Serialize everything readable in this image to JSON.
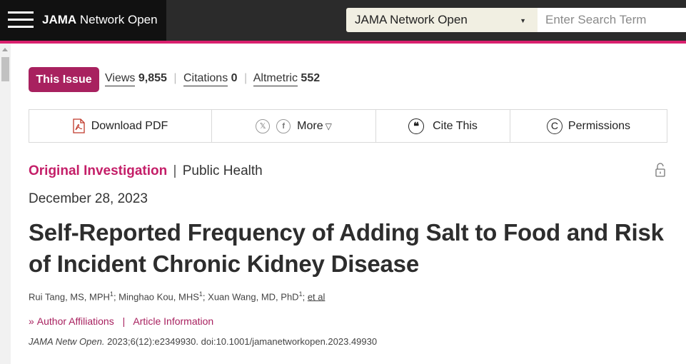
{
  "header": {
    "brand_bold": "JAMA",
    "brand_rest": " Network Open",
    "journal_select_value": "JAMA Network Open",
    "search_placeholder": "Enter Search Term"
  },
  "metrics": {
    "this_issue_label": "This Issue",
    "views_label": "Views",
    "views_value": "9,855",
    "citations_label": "Citations",
    "citations_value": "0",
    "altmetric_label": "Altmetric",
    "altmetric_value": "552"
  },
  "toolbar": {
    "download_pdf_label": "Download PDF",
    "more_label": "More",
    "cite_label": "Cite This",
    "permissions_label": "Permissions",
    "x_icon_glyph": "𝕏",
    "facebook_icon_glyph": "f"
  },
  "article": {
    "type": "Original Investigation",
    "topic": "Public Health",
    "date": "December 28, 2023",
    "title": "Self-Reported Frequency of Adding Salt to Food and Risk of Incident Chronic Kidney Disease",
    "authors": [
      {
        "name": "Rui Tang, MS, MPH",
        "sup": "1"
      },
      {
        "name": "Minghao Kou, MHS",
        "sup": "1"
      },
      {
        "name": "Xuan Wang, MD, PhD",
        "sup": "1"
      }
    ],
    "et_al": "et al",
    "author_affiliations_label": "Author Affiliations",
    "article_information_label": "Article Information",
    "citation_journal": "JAMA Netw Open.",
    "citation_rest": " 2023;6(12):e2349930. doi:10.1001/jamanetworkopen.2023.49930"
  },
  "colors": {
    "accent_pink": "#d9206e",
    "this_issue_bg": "#a8215f",
    "article_type": "#c41e68"
  }
}
